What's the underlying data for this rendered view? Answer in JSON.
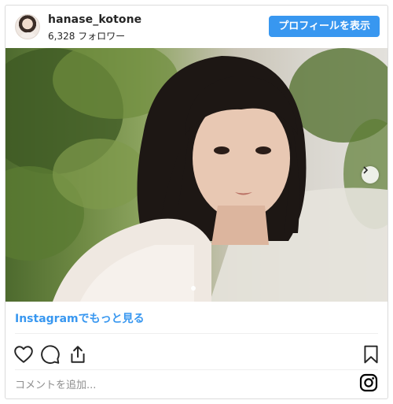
{
  "header": {
    "username": "hanase_kotone",
    "followers": "6,328 フォロワー",
    "profile_button": "プロフィールを表示"
  },
  "post": {
    "more_link": "Instagramでもっと見る",
    "comment_placeholder": "コメントを追加..."
  },
  "icons": {
    "like": "heart-icon",
    "comment": "comment-icon",
    "share": "share-icon",
    "save": "bookmark-icon",
    "brand": "instagram-icon",
    "next": "chevron-right-icon"
  },
  "colors": {
    "accent": "#3897f0",
    "text": "#262626",
    "muted": "#8e8e8e",
    "border": "#dbdbdb"
  }
}
